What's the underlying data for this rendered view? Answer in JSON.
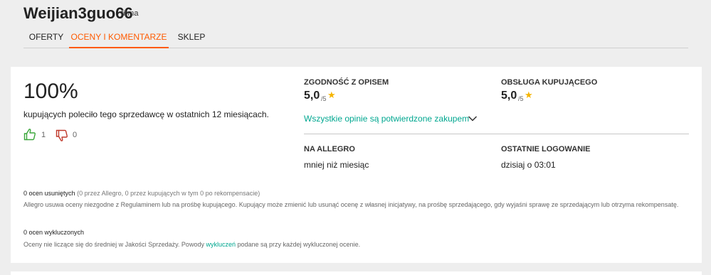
{
  "seller": {
    "name": "Weijian3guo66",
    "type": "firma"
  },
  "tabs": [
    {
      "label": "OFERTY",
      "active": false
    },
    {
      "label": "OCENY I KOMENTARZE",
      "active": true
    },
    {
      "label": "SKLEP",
      "active": false
    }
  ],
  "summary": {
    "percent": "100%",
    "text": "kupujących poleciło tego sprzedawcę w ostatnich 12 miesiącach.",
    "positive_count": "1",
    "negative_count": "0"
  },
  "metrics": {
    "description": {
      "label": "ZGODNOŚĆ Z OPISEM",
      "value": "5,0",
      "suffix": "/5"
    },
    "service": {
      "label": "OBSŁUGA KUPUJĄCEGO",
      "value": "5,0",
      "suffix": "/5"
    }
  },
  "verified_link": "Wszystkie opinie są potwierdzone zakupem",
  "info": {
    "on_allegro": {
      "label": "NA ALLEGRO",
      "value": "mniej niż miesiąc"
    },
    "last_login": {
      "label": "OSTATNIE LOGOWANIE",
      "value": "dzisiaj o 03:01"
    }
  },
  "removed": {
    "title": "0 ocen usuniętych",
    "detail": "(0 przez Allegro, 0 przez kupujących w tym 0 po rekompensacie)",
    "text": "Allegro usuwa oceny niezgodne z Regulaminem lub na prośbę kupującego. Kupujący może zmienić lub usunąć ocenę z własnej inicjatywy, na prośbę sprzedającego, gdy wyjaśni sprawę ze sprzedającym lub otrzyma rekompensatę."
  },
  "excluded": {
    "title": "0 ocen wykluczonych",
    "text_before": "Oceny nie liczące się do średniej w Jakości Sprzedaży. Powody ",
    "link": "wykluczeń",
    "text_after": " podane są przy każdej wykluczonej ocenie."
  },
  "colors": {
    "accent": "#ff5a00",
    "link": "#00a790",
    "star": "#f5b400",
    "thumb_up": "#3aa63a",
    "thumb_down": "#c0392b"
  },
  "icons": {
    "star": "star-icon",
    "thumb_up": "thumb-up-icon",
    "thumb_down": "thumb-down-icon",
    "chevron": "chevron-down-icon"
  }
}
